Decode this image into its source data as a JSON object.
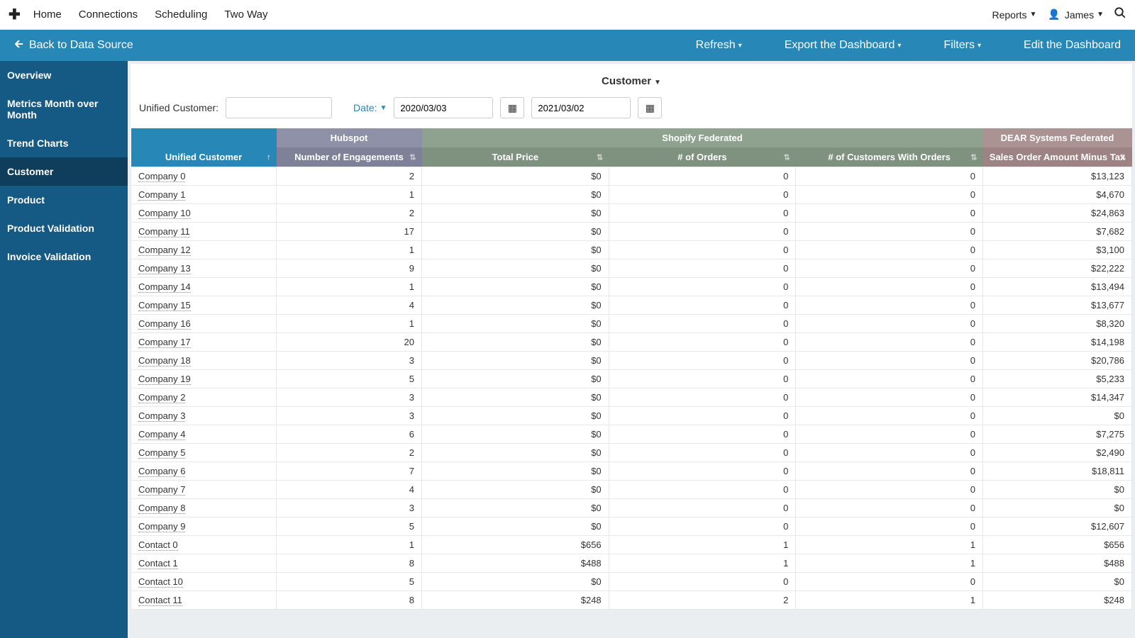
{
  "topnav": {
    "home": "Home",
    "connections": "Connections",
    "scheduling": "Scheduling",
    "twoway": "Two Way",
    "reports": "Reports",
    "user": "James"
  },
  "subbar": {
    "back": "Back to Data Source",
    "refresh": "Refresh",
    "export": "Export the Dashboard",
    "filters": "Filters",
    "edit": "Edit the Dashboard"
  },
  "sidebar": {
    "items": [
      {
        "label": "Overview"
      },
      {
        "label": "Metrics Month over Month"
      },
      {
        "label": "Trend Charts"
      },
      {
        "label": "Customer"
      },
      {
        "label": "Product"
      },
      {
        "label": "Product Validation"
      },
      {
        "label": "Invoice Validation"
      }
    ]
  },
  "panel": {
    "title": "Customer",
    "filter_label": "Unified Customer:",
    "filter_value": "",
    "date_label": "Date:",
    "date_from": "2020/03/03",
    "date_to": "2021/03/02"
  },
  "table": {
    "groups": {
      "uc": "",
      "hs": "Hubspot",
      "sh": "Shopify Federated",
      "dear": "DEAR Systems Federated"
    },
    "headers": {
      "uc": "Unified Customer",
      "hs": "Number of Engagements",
      "tp": "Total Price",
      "ord": "# of Orders",
      "cwo": "# of Customers With Orders",
      "so": "Sales Order Amount Minus Tax"
    },
    "rows": [
      {
        "name": "Company 0",
        "eng": "2",
        "tp": "$0",
        "ord": "0",
        "cwo": "0",
        "so": "$13,123"
      },
      {
        "name": "Company 1",
        "eng": "1",
        "tp": "$0",
        "ord": "0",
        "cwo": "0",
        "so": "$4,670"
      },
      {
        "name": "Company 10",
        "eng": "2",
        "tp": "$0",
        "ord": "0",
        "cwo": "0",
        "so": "$24,863"
      },
      {
        "name": "Company 11",
        "eng": "17",
        "tp": "$0",
        "ord": "0",
        "cwo": "0",
        "so": "$7,682"
      },
      {
        "name": "Company 12",
        "eng": "1",
        "tp": "$0",
        "ord": "0",
        "cwo": "0",
        "so": "$3,100"
      },
      {
        "name": "Company 13",
        "eng": "9",
        "tp": "$0",
        "ord": "0",
        "cwo": "0",
        "so": "$22,222"
      },
      {
        "name": "Company 14",
        "eng": "1",
        "tp": "$0",
        "ord": "0",
        "cwo": "0",
        "so": "$13,494"
      },
      {
        "name": "Company 15",
        "eng": "4",
        "tp": "$0",
        "ord": "0",
        "cwo": "0",
        "so": "$13,677"
      },
      {
        "name": "Company 16",
        "eng": "1",
        "tp": "$0",
        "ord": "0",
        "cwo": "0",
        "so": "$8,320"
      },
      {
        "name": "Company 17",
        "eng": "20",
        "tp": "$0",
        "ord": "0",
        "cwo": "0",
        "so": "$14,198"
      },
      {
        "name": "Company 18",
        "eng": "3",
        "tp": "$0",
        "ord": "0",
        "cwo": "0",
        "so": "$20,786"
      },
      {
        "name": "Company 19",
        "eng": "5",
        "tp": "$0",
        "ord": "0",
        "cwo": "0",
        "so": "$5,233"
      },
      {
        "name": "Company 2",
        "eng": "3",
        "tp": "$0",
        "ord": "0",
        "cwo": "0",
        "so": "$14,347"
      },
      {
        "name": "Company 3",
        "eng": "3",
        "tp": "$0",
        "ord": "0",
        "cwo": "0",
        "so": "$0"
      },
      {
        "name": "Company 4",
        "eng": "6",
        "tp": "$0",
        "ord": "0",
        "cwo": "0",
        "so": "$7,275"
      },
      {
        "name": "Company 5",
        "eng": "2",
        "tp": "$0",
        "ord": "0",
        "cwo": "0",
        "so": "$2,490"
      },
      {
        "name": "Company 6",
        "eng": "7",
        "tp": "$0",
        "ord": "0",
        "cwo": "0",
        "so": "$18,811"
      },
      {
        "name": "Company 7",
        "eng": "4",
        "tp": "$0",
        "ord": "0",
        "cwo": "0",
        "so": "$0"
      },
      {
        "name": "Company 8",
        "eng": "3",
        "tp": "$0",
        "ord": "0",
        "cwo": "0",
        "so": "$0"
      },
      {
        "name": "Company 9",
        "eng": "5",
        "tp": "$0",
        "ord": "0",
        "cwo": "0",
        "so": "$12,607"
      },
      {
        "name": "Contact 0",
        "eng": "1",
        "tp": "$656",
        "ord": "1",
        "cwo": "1",
        "so": "$656"
      },
      {
        "name": "Contact 1",
        "eng": "8",
        "tp": "$488",
        "ord": "1",
        "cwo": "1",
        "so": "$488"
      },
      {
        "name": "Contact 10",
        "eng": "5",
        "tp": "$0",
        "ord": "0",
        "cwo": "0",
        "so": "$0"
      },
      {
        "name": "Contact 11",
        "eng": "8",
        "tp": "$248",
        "ord": "2",
        "cwo": "1",
        "so": "$248"
      }
    ]
  }
}
